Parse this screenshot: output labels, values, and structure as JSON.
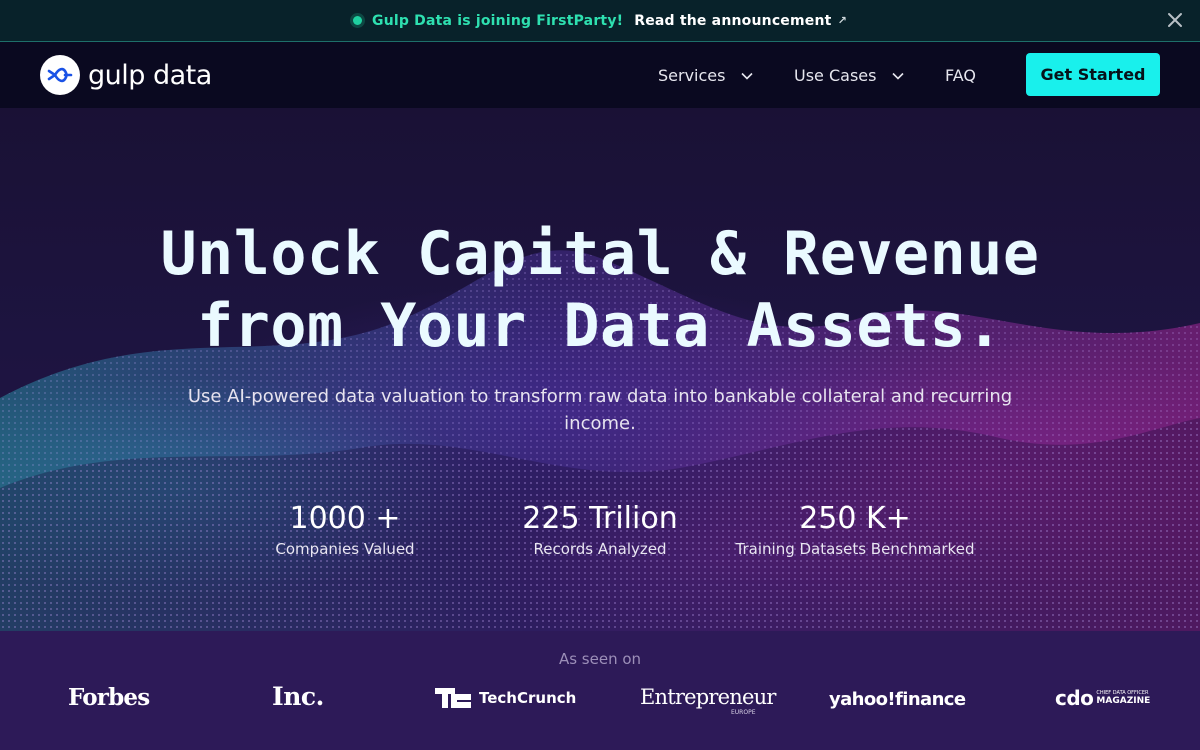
{
  "announcement": {
    "message": "Gulp Data is joining FirstParty!",
    "link_label": "Read the announcement",
    "link_icon": "↗",
    "dot_color": "#1fd0a0"
  },
  "nav": {
    "logo_text": "gulp data",
    "items": [
      {
        "label": "Services",
        "has_dropdown": true
      },
      {
        "label": "Use Cases",
        "has_dropdown": true
      },
      {
        "label": "FAQ",
        "has_dropdown": false
      }
    ],
    "cta_label": "Get Started",
    "cta_color": "#19f0ec"
  },
  "hero": {
    "title_line1": "Unlock Capital & Revenue",
    "title_line2": "from Your Data Assets.",
    "subtitle": "Use AI-powered data valuation to transform raw data into bankable collateral and recurring income.",
    "stats": [
      {
        "value": "1000 +",
        "label": "Companies Valued"
      },
      {
        "value": "225 Trilion",
        "label": "Records Analyzed"
      },
      {
        "value": "250 K+",
        "label": "Training Datasets Benchmarked"
      }
    ]
  },
  "press": {
    "heading": "As seen on",
    "logos": [
      {
        "name": "Forbes",
        "text": "Forbes"
      },
      {
        "name": "Inc.",
        "text": "Inc."
      },
      {
        "name": "TechCrunch",
        "text": "TechCrunch"
      },
      {
        "name": "Entrepreneur",
        "text": "Entrepreneur",
        "sub": "EUROPE"
      },
      {
        "name": "Yahoo Finance",
        "text": "yahoo!finance"
      },
      {
        "name": "CDO Magazine",
        "text": "cdo",
        "sub": "CHIEF DATA OFFICER",
        "sub2": "MAGAZINE"
      }
    ]
  }
}
